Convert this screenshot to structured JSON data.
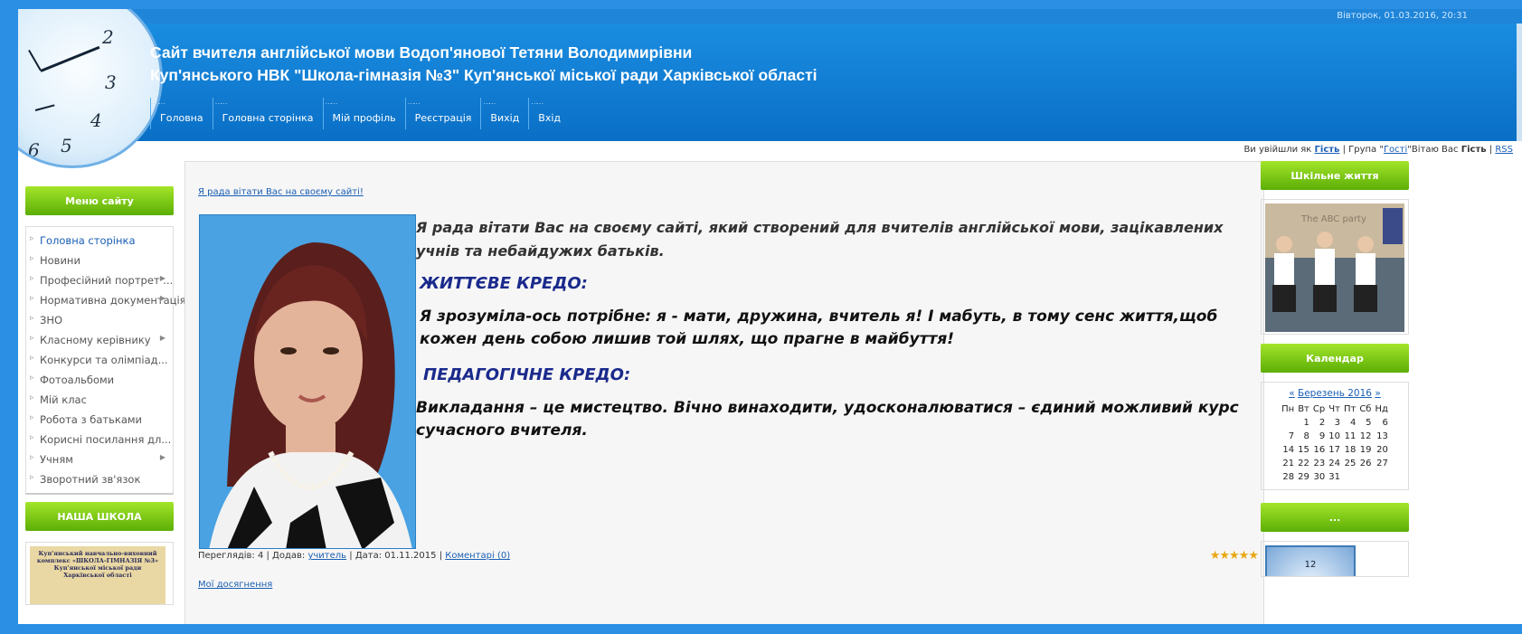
{
  "datetime": "Вівторок, 01.03.2016, 20:31",
  "site": {
    "title_line1": "Сайт вчителя англійської мови Водоп'янової Тетяни Володимирівни",
    "title_line2": "Куп'янського НВК \"Школа-гімназія №3\" Куп'янської міської ради Харківської області"
  },
  "clock_numbers": [
    "2",
    "3",
    "4",
    "5",
    "6"
  ],
  "nav": [
    "Головна",
    "Головна сторінка",
    "Мій профіль",
    "Реєстрація",
    "Вихід",
    "Вхід"
  ],
  "userline": {
    "prefix": "Ви увійшли як",
    "user": "Гість",
    "group_prefix": "| Група \"",
    "group": "Гості",
    "greeting": "\"Вітаю Вас",
    "greeting_user": "Гість",
    "sep": "|",
    "rss": "RSS"
  },
  "left": {
    "menu_title": "Меню сайту",
    "menu": [
      {
        "label": "Головна сторінка",
        "sub": false
      },
      {
        "label": "Новини",
        "sub": false
      },
      {
        "label": "Професійний портрет ...",
        "sub": true
      },
      {
        "label": "Нормативна документація",
        "sub": true
      },
      {
        "label": "ЗНО",
        "sub": false
      },
      {
        "label": "Класному керівнику",
        "sub": true
      },
      {
        "label": "Конкурси та олімпіад...",
        "sub": false
      },
      {
        "label": "Фотоальбоми",
        "sub": false
      },
      {
        "label": "Мій клас",
        "sub": false
      },
      {
        "label": "Робота з батьками",
        "sub": false
      },
      {
        "label": "Корисні посилання дл...",
        "sub": false
      },
      {
        "label": "Учням",
        "sub": true
      },
      {
        "label": "Зворотний зв'язок",
        "sub": false
      }
    ],
    "school_title": "НАША ШКОЛА",
    "school_text": "Куп'янський навчально-виховний комплекс «ШКОЛА-ГІМНАЗІЯ №3» Куп'янської міської ради Харківської області"
  },
  "main": {
    "link": "Я рада вітати Вас на своєму сайті!",
    "p1": "Я рада вітати Вас на своєму сайті, який створений для вчителів англійської мови, зацікавлених учнів та небайдужих батьків.",
    "h1": "ЖИТТЄВЕ  КРЕДО:",
    "p2": "Я зрозуміла-ось потрібне: я - мати, дружина, вчитель я!  І мабуть, в тому сенс життя,щоб кожен день собою лишив той шлях, що прагне в  майбуття!",
    "h2": "ПЕДАГОГІЧНЕ КРЕДО:",
    "p3": "Викладання – це мистецтво. Вічно винаходити, удосконалюватися – єдиний можливий курс сучасного вчителя.",
    "meta_views": "Переглядів: 4 | Додав:",
    "meta_author": "учитель",
    "meta_date": "| Дата: 01.11.2015 |",
    "meta_comments": "Коментарі (0)",
    "stars": "★★★★★",
    "achievements": "Мої досягнення"
  },
  "right": {
    "life_title": "Шкільне життя",
    "photo_caption": "The ABC party",
    "calendar_title": "Календар",
    "cal_prev": "«",
    "cal_month": "Березень 2016",
    "cal_next": "»",
    "weekdays": [
      "Пн",
      "Вт",
      "Ср",
      "Чт",
      "Пт",
      "Сб",
      "Нд"
    ],
    "weeks": [
      [
        "",
        "1",
        "2",
        "3",
        "4",
        "5",
        "6"
      ],
      [
        "7",
        "8",
        "9",
        "10",
        "11",
        "12",
        "13"
      ],
      [
        "14",
        "15",
        "16",
        "17",
        "18",
        "19",
        "20"
      ],
      [
        "21",
        "22",
        "23",
        "24",
        "25",
        "26",
        "27"
      ],
      [
        "28",
        "29",
        "30",
        "31",
        "",
        "",
        ""
      ]
    ],
    "more_title": "...",
    "clock_label": "12"
  }
}
